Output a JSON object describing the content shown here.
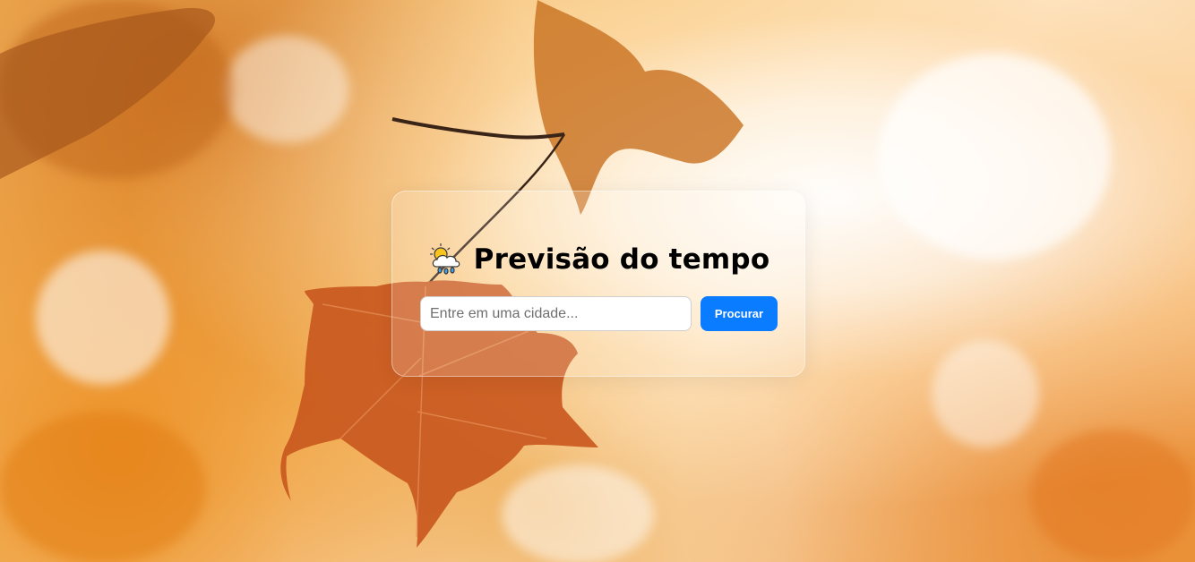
{
  "card": {
    "title": "Previsão do tempo",
    "icon": "cloud-sun-rain-icon"
  },
  "search": {
    "placeholder": "Entre em uma cidade...",
    "value": "",
    "button_label": "Procurar"
  },
  "colors": {
    "button": "#0a7cff",
    "title": "#000000"
  }
}
